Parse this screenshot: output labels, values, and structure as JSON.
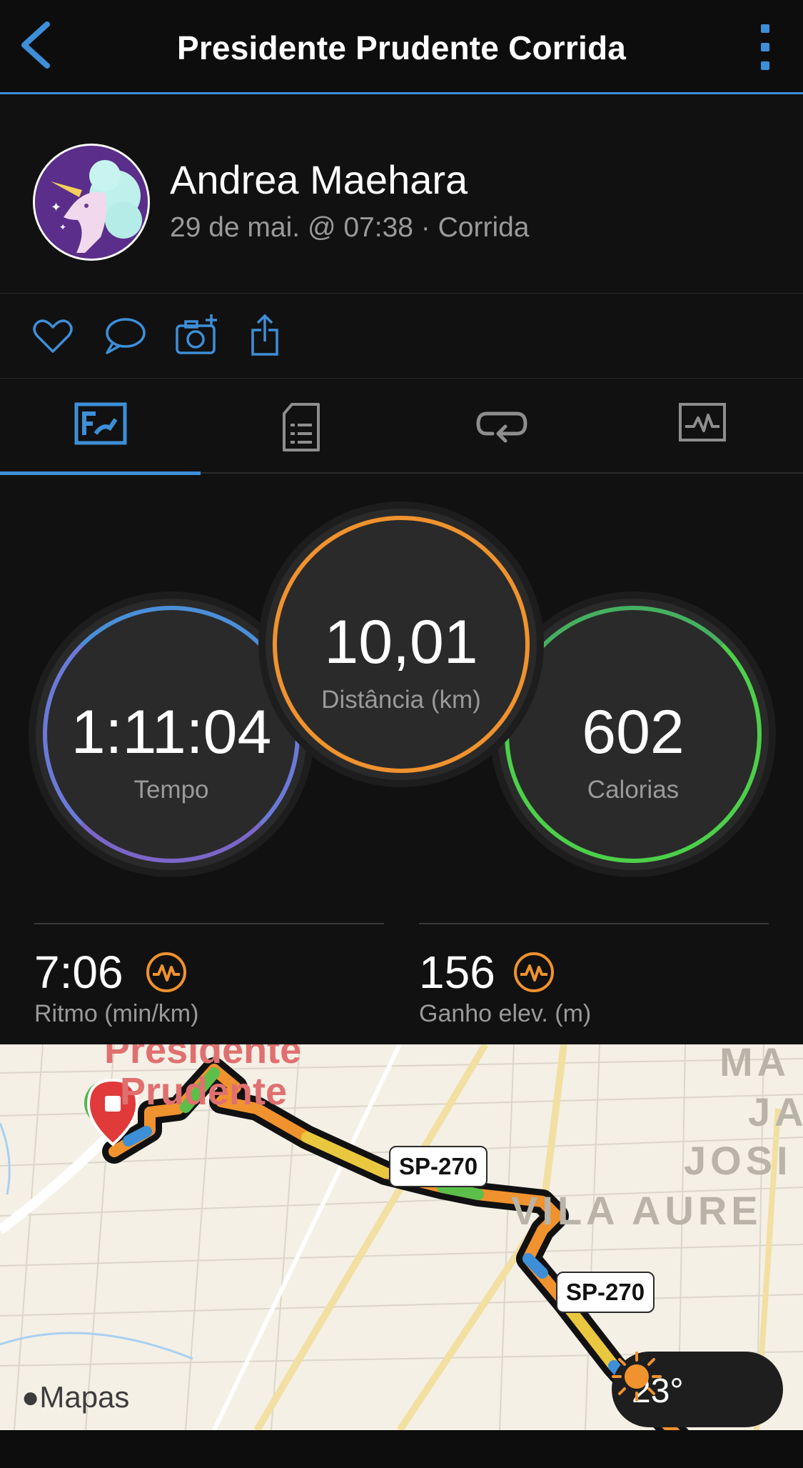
{
  "header": {
    "title": "Presidente Prudente Corrida"
  },
  "user": {
    "name": "Andrea Maehara",
    "subtitle": "29 de mai. @ 07:38 · Corrida"
  },
  "actions": [
    "heart-icon",
    "comment-icon",
    "add-photo-icon",
    "share-icon"
  ],
  "tabs": [
    {
      "icon": "stats-overview-icon",
      "active": true
    },
    {
      "icon": "details-list-icon",
      "active": false
    },
    {
      "icon": "laps-icon",
      "active": false
    },
    {
      "icon": "charts-icon",
      "active": false
    }
  ],
  "stats": {
    "time": {
      "value": "1:11:04",
      "label": "Tempo"
    },
    "distance": {
      "value": "10,01",
      "label": "Distância (km)"
    },
    "calories": {
      "value": "602",
      "label": "Calorias"
    },
    "pace": {
      "value": "7:06",
      "label": "Ritmo (min/km)"
    },
    "elevation": {
      "value": "156",
      "label": "Ganho elev. (m)"
    }
  },
  "colors": {
    "accent": "#3d8fd8",
    "time_ring": "#6b7ad8",
    "distance_ring": "#f0922e",
    "calories_ring": "#4cd04a"
  },
  "map": {
    "city_line1": "Presidente",
    "city_line2": "Prudente",
    "road_shield_1": "SP-270",
    "road_shield_2": "SP-270",
    "district_1": "MA",
    "district_2": "JA",
    "district_3": "JOSI",
    "district_4": "VILA AURE",
    "attribution": "Mapas",
    "weather_temp": "23°"
  }
}
